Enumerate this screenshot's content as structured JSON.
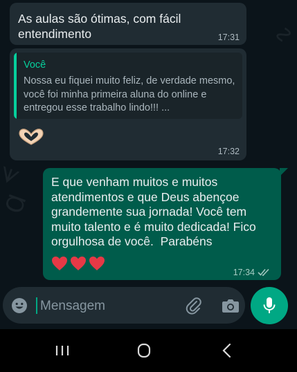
{
  "conversation": {
    "messages": [
      {
        "direction": "incoming",
        "text": "As aulas são ótimas, com fácil\nentendimento",
        "time": "17:31"
      },
      {
        "direction": "incoming",
        "quoted": {
          "author": "Você",
          "text": "Nossa eu fiquei muito feliz, de verdade mesmo, você foi minha primeira aluna do online e entregou esse trabalho lindo!!! ..."
        },
        "emoji": "heart-hands-emoji",
        "time": "17:32"
      },
      {
        "direction": "outgoing",
        "text": "E que venham muitos e muitos atendimentos e que Deus abençoe grandemente sua jornada! Você tem muito talento e é muito dedicada! Fico orgulhosa de você.  Parabéns",
        "emoji": "red-heart-emoji x3",
        "time": "17:34",
        "status": "read"
      }
    ]
  },
  "composer": {
    "placeholder": "Mensagem",
    "icons": [
      "emoji-icon",
      "attach-icon",
      "camera-icon",
      "microphone-icon"
    ]
  },
  "navigation_bar": {
    "buttons": [
      "recents-button",
      "home-button",
      "back-button"
    ]
  },
  "colors": {
    "background": "#0b141a",
    "incoming_bubble": "#202c33",
    "outgoing_bubble": "#005c4b",
    "accent": "#00a884",
    "quote_author": "#06cf9c",
    "heart": "#e63946"
  }
}
